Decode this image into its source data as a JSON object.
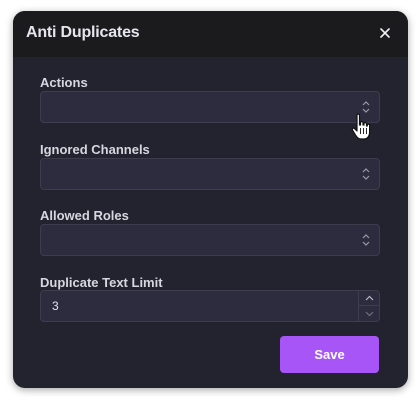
{
  "modal": {
    "title": "Anti Duplicates",
    "close_icon": "close-icon"
  },
  "fields": {
    "actions": {
      "label": "Actions",
      "value": "",
      "icon": "chevron-up-down-icon"
    },
    "ignored_channels": {
      "label": "Ignored Channels",
      "value": "",
      "icon": "chevron-up-down-icon"
    },
    "allowed_roles": {
      "label": "Allowed Roles",
      "value": "",
      "icon": "chevron-up-down-icon"
    },
    "duplicate_text_limit": {
      "label": "Duplicate Text Limit",
      "value": "3"
    }
  },
  "actions": {
    "save_label": "Save"
  },
  "colors": {
    "modal_bg": "#23232f",
    "header_bg": "#1b1b1d",
    "input_bg": "#2c2c3e",
    "input_border": "#3d3d4e",
    "accent": "#a855f7"
  }
}
